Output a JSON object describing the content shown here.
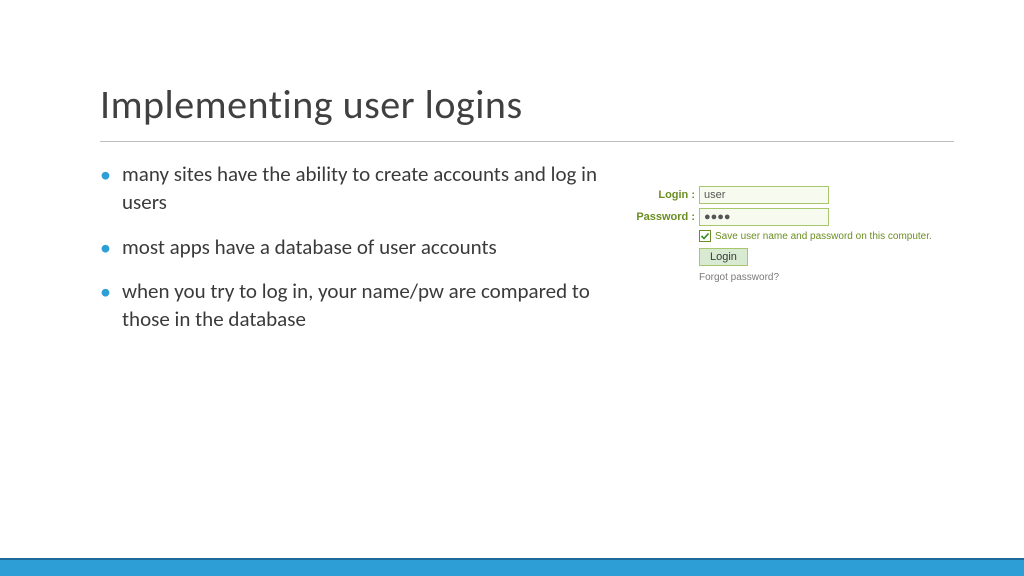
{
  "title": "Implementing user logins",
  "bullets": [
    "many sites have the ability to create accounts and log in users",
    "most apps have a database of user accounts",
    "when you try to log in, your name/pw are compared to those in the database"
  ],
  "login_form": {
    "login_label": "Login :",
    "login_value": "user",
    "password_label": "Password :",
    "password_value": "●●●●",
    "save_checkbox_checked": true,
    "save_label": "Save user name and password on this computer.",
    "button": "Login",
    "forgot": "Forgot password?"
  }
}
